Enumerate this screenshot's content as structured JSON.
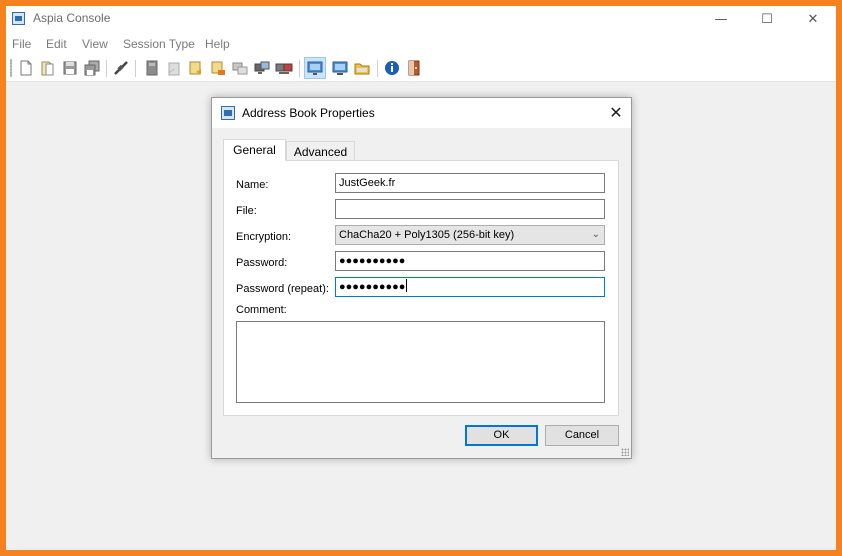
{
  "app": {
    "title": "Aspia Console",
    "minimize_glyph": "—",
    "maximize_glyph": "☐",
    "close_glyph": "✕"
  },
  "menu": [
    "File",
    "Edit",
    "View",
    "Session Type",
    "Help"
  ],
  "toolbar_icons": [
    "new-file-icon",
    "open-file-icon",
    "save-icon",
    "save-all-icon",
    "disconnect-icon",
    "add-group-icon",
    "delete-group-icon",
    "add-computer-icon",
    "delete-computer-icon",
    "copy-computer-icon",
    "connect-desktop-icon",
    "connect-view-icon",
    "desktop-manage-icon",
    "desktop-view-icon",
    "file-transfer-icon",
    "about-icon",
    "exit-icon"
  ],
  "dialog": {
    "title": "Address Book Properties",
    "close_glyph": "✕",
    "tabs": [
      "General",
      "Advanced"
    ],
    "name_label": "Name:",
    "name_value": "JustGeek.fr",
    "file_label": "File:",
    "file_value": "",
    "encryption_label": "Encryption:",
    "encryption_value": "ChaCha20 + Poly1305 (256-bit key)",
    "dropdown_glyph": "⌄",
    "password_label": "Password:",
    "password_value": "●●●●●●●●●●",
    "password_repeat_label": "Password (repeat):",
    "password_repeat_value": "●●●●●●●●●●",
    "comment_label": "Comment:",
    "comment_value": "",
    "ok_label": "OK",
    "cancel_label": "Cancel"
  },
  "colors": {
    "frame": "#f5821f",
    "accent": "#0078d7"
  }
}
